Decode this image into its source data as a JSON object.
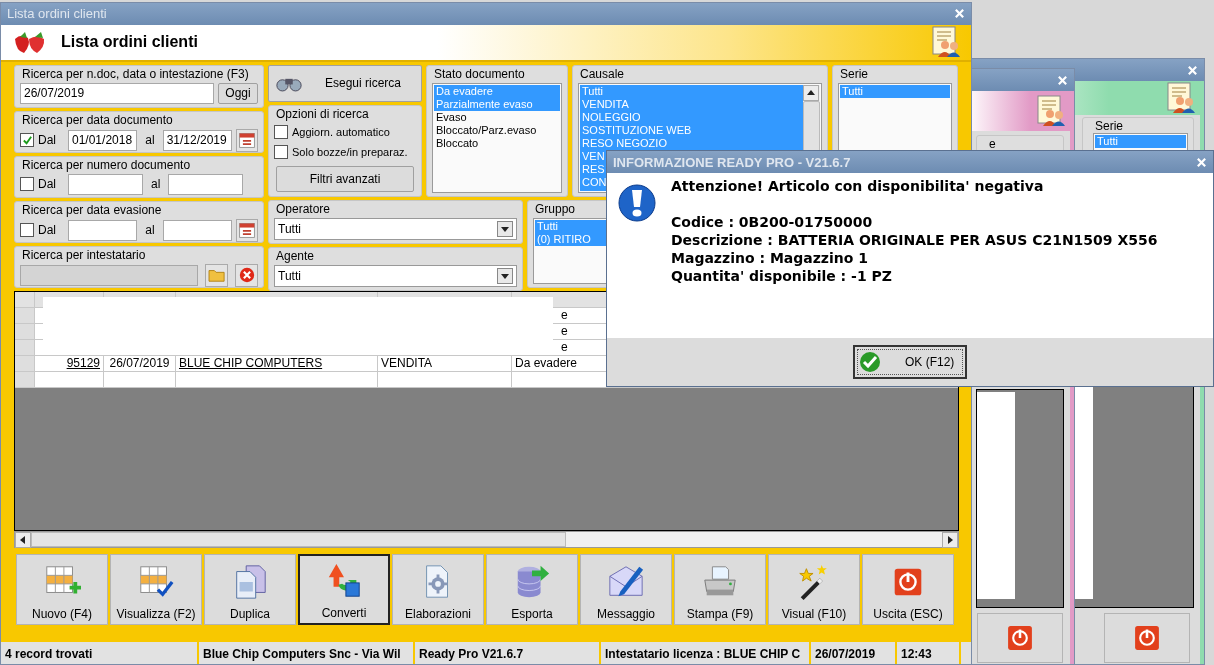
{
  "main_window": {
    "title": "Lista ordini clienti",
    "heading": "Lista ordini clienti",
    "quick_search": {
      "label": "Ricerca per n.doc, data o intestazione (F3)",
      "value": "26/07/2019",
      "button": "Oggi"
    },
    "range_filters": [
      {
        "label": "Ricerca per data documento",
        "checkbox": "Dal",
        "checked": true,
        "from": "01/01/2018",
        "separator": "al",
        "to": "31/12/2019",
        "calendar": true
      },
      {
        "label": "Ricerca per numero documento",
        "checkbox": "Dal",
        "checked": false,
        "separator": "al",
        "calendar": false
      },
      {
        "label": "Ricerca per data evasione",
        "checkbox": "Dal",
        "checked": false,
        "separator": "al",
        "calendar": true
      }
    ],
    "holder_filter": {
      "label": "Ricerca per intestatario",
      "disabled": true
    },
    "search_button": "Esegui ricerca",
    "options": {
      "label": "Opzioni di ricerca",
      "checkboxes": [
        {
          "label": "Aggiorn. automatico",
          "checked": false
        },
        {
          "label": "Solo bozze/in preparaz.",
          "checked": false
        }
      ],
      "button": "Filtri avanzati"
    },
    "stato_documento": {
      "label": "Stato documento",
      "items": [
        {
          "text": "Da evadere",
          "selected": true
        },
        {
          "text": "Parzialmente evaso",
          "selected": true
        },
        {
          "text": "Evaso",
          "selected": false
        },
        {
          "text": "Bloccato/Parz.evaso",
          "selected": false
        },
        {
          "text": "Bloccato",
          "selected": false
        }
      ]
    },
    "causale": {
      "label": "Causale",
      "items": [
        {
          "text": "Tutti",
          "selected": true
        },
        {
          "text": "VENDITA",
          "selected": true
        },
        {
          "text": "NOLEGGIO",
          "selected": true
        },
        {
          "text": "SOSTITUZIONE WEB",
          "selected": true
        },
        {
          "text": "RESO NEGOZIO",
          "selected": true
        },
        {
          "text": "VEN",
          "selected": true
        },
        {
          "text": "RES",
          "selected": true
        },
        {
          "text": "CON",
          "selected": true
        }
      ]
    },
    "serie": {
      "label": "Serie",
      "items": [
        {
          "text": "Tutti",
          "selected": true
        }
      ]
    },
    "operatore": {
      "label": "Operatore",
      "value": "Tutti"
    },
    "agente": {
      "label": "Agente",
      "value": "Tutti"
    },
    "gruppo": {
      "label": "Gruppo",
      "items": [
        {
          "text": "Tutti",
          "selected": true
        },
        {
          "text": "(0) RITIRO",
          "selected": true
        }
      ]
    },
    "table": {
      "rows": [
        {
          "redacted": true,
          "stato": "e"
        },
        {
          "redacted": true,
          "stato": "e"
        },
        {
          "redacted": true,
          "stato": "e"
        },
        {
          "redacted": false,
          "nr_doc": "95129",
          "data": "26/07/2019",
          "intestatario": "BLUE CHIP COMPUTERS",
          "causale": "VENDITA",
          "stato": "Da evadere"
        }
      ]
    },
    "buttons": [
      {
        "label": "Nuovo (F4)",
        "kind": "new",
        "focused": false
      },
      {
        "label": "Visualizza (F2)",
        "kind": "view",
        "focused": false
      },
      {
        "label": "Duplica",
        "kind": "duplicate",
        "focused": false
      },
      {
        "label": "Converti",
        "kind": "convert",
        "focused": true
      },
      {
        "label": "Elaborazioni",
        "kind": "process",
        "focused": false
      },
      {
        "label": "Esporta",
        "kind": "export",
        "focused": false
      },
      {
        "label": "Messaggio",
        "kind": "message",
        "focused": false
      },
      {
        "label": "Stampa (F9)",
        "kind": "print",
        "focused": false
      },
      {
        "label": "Visual (F10)",
        "kind": "visual",
        "focused": false
      },
      {
        "label": "Uscita (ESC)",
        "kind": "exit",
        "focused": false
      }
    ],
    "status_bar": [
      "4 record trovati",
      "Blue Chip Computers Snc - Via Wil",
      "Ready Pro V21.6.7",
      "Intestatario licenza : BLUE CHIP C",
      "26/07/2019",
      "12:43"
    ]
  },
  "background_windows": [
    {
      "color": "#e29ac6",
      "group_label": "e"
    },
    {
      "color": "#8fdcae",
      "group_label": "Serie",
      "items": [
        {
          "text": "Tutti",
          "selected": true
        }
      ]
    }
  ],
  "dialog": {
    "title": "INFORMAZIONE READY PRO - V21.6.7",
    "heading": "Attenzione! Articolo con disponibilita' negativa",
    "lines": [
      "Codice : 0B200-01750000",
      "Descrizione : BATTERIA ORIGINALE PER ASUS C21N1509 X556",
      "Magazzino : Magazzino 1",
      "Quantita' disponibile : -1 PZ"
    ],
    "button": "OK (F12)"
  }
}
